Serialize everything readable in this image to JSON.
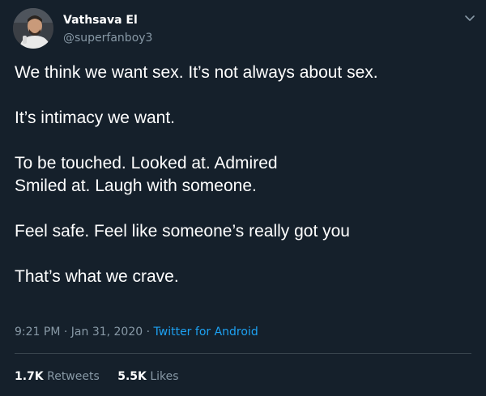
{
  "user": {
    "display_name": "Vathsava El",
    "handle": "@superfanboy3"
  },
  "tweet": {
    "lines": [
      "We think we want sex. It’s not always about sex.",
      "",
      "It’s intimacy we want.",
      "",
      "To be touched. Looked at. Admired",
      "Smiled at. Laugh with someone.",
      "",
      "Feel safe. Feel like someone’s really got you",
      "",
      "That’s what we crave."
    ],
    "time": "9:21 PM",
    "date": "Jan 31, 2020",
    "separator": "·",
    "source": "Twitter for Android"
  },
  "stats": {
    "retweets_count": "1.7K",
    "retweets_label": "Retweets",
    "likes_count": "5.5K",
    "likes_label": "Likes"
  },
  "icons": {
    "caret": "chevron-down-icon",
    "avatar": "profile-photo"
  },
  "colors": {
    "background": "#15202b",
    "text": "#ffffff",
    "secondary": "#8899a6",
    "accent": "#1da1f2",
    "divider": "#38444d"
  }
}
